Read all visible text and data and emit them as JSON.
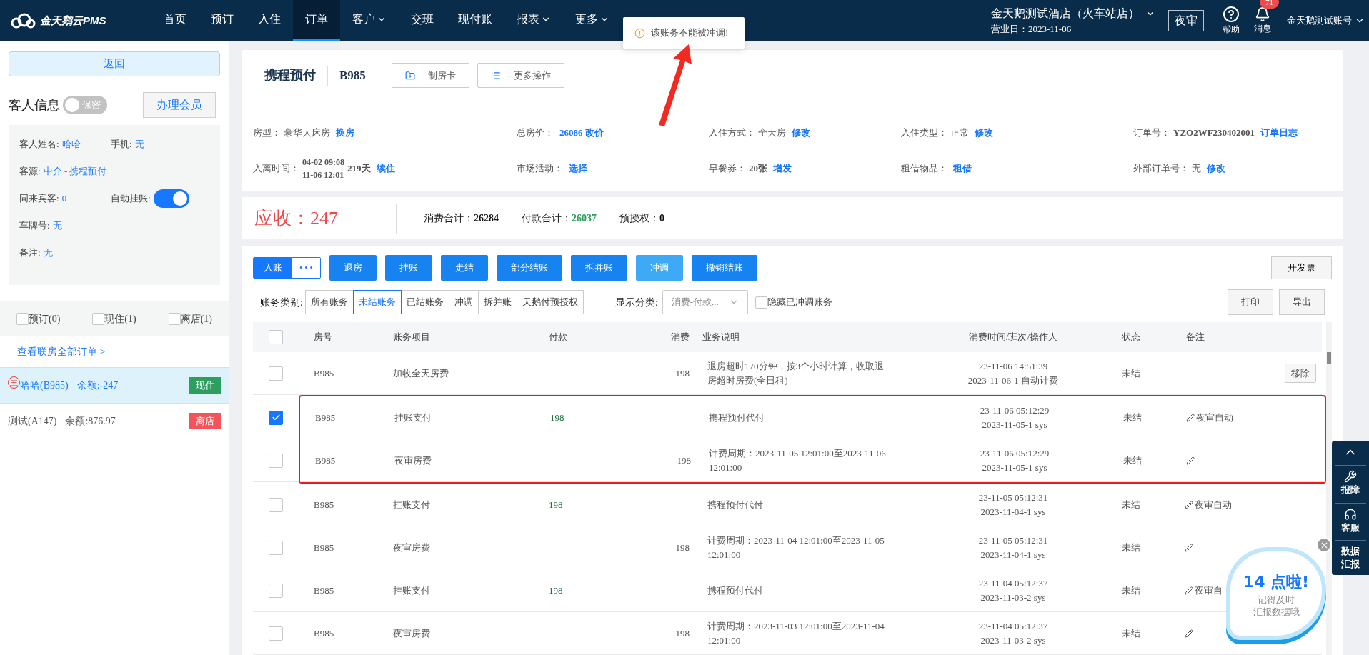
{
  "nav": {
    "logo": "金天鹅云PMS",
    "items": [
      {
        "label": "首页",
        "selected": false,
        "dropdown": false
      },
      {
        "label": "预订",
        "selected": false,
        "dropdown": false
      },
      {
        "label": "入住",
        "selected": false,
        "dropdown": false
      },
      {
        "label": "订单",
        "selected": true,
        "dropdown": false
      },
      {
        "label": "客户",
        "selected": false,
        "dropdown": true
      },
      {
        "label": "交班",
        "selected": false,
        "dropdown": false
      },
      {
        "label": "现付账",
        "selected": false,
        "dropdown": false
      },
      {
        "label": "报表",
        "selected": false,
        "dropdown": true
      },
      {
        "label": "更多",
        "selected": false,
        "dropdown": true
      }
    ],
    "hotel": "金天鹅测试酒店（火车站店）",
    "business_date": "营业日：2023-11-06",
    "night_audit": "夜审",
    "help": "帮助",
    "messages": "消息",
    "message_count": "71",
    "account": "金天鹅测试账号"
  },
  "toast": {
    "text": "该账务不能被冲调!"
  },
  "sidebar": {
    "back": "返回",
    "guest_info_title": "客人信息",
    "privacy": {
      "label": "保密",
      "on": false
    },
    "member_button": "办理会员",
    "field_rows": [
      [
        {
          "kind": "text",
          "label": "客人姓名:",
          "value": "哈哈"
        },
        {
          "kind": "text",
          "label": "手机:",
          "value": "无"
        }
      ],
      [
        {
          "kind": "text",
          "label": "客源:",
          "value": "中介  - 携程预付"
        }
      ],
      [
        {
          "kind": "text",
          "label": "同来宾客:",
          "value": "0"
        },
        {
          "kind": "toggle",
          "label": "自动挂账:",
          "on": true
        }
      ],
      [
        {
          "kind": "text",
          "label": "车牌号:",
          "value": "无"
        }
      ],
      [
        {
          "kind": "text",
          "label": "备注:",
          "value": "无"
        }
      ]
    ],
    "filters": [
      {
        "label": "预订(0)",
        "checked": false
      },
      {
        "label": "现住(1)",
        "checked": false
      },
      {
        "label": "离店(1)",
        "checked": false
      }
    ],
    "all_orders_link": "查看联房全部订单 >",
    "rooms": [
      {
        "main_mark": "主",
        "name": "哈哈(B985)",
        "balance": "余额:-247",
        "status": "现住",
        "color": "#2e9e5e",
        "selected": true
      },
      {
        "name": "测试(A147)",
        "balance": "余额:876.97",
        "status": "离店",
        "color": "#f5535a",
        "selected": false
      }
    ]
  },
  "order": {
    "channel": "携程预付",
    "room": "B985",
    "buttons": [
      {
        "label": "制房卡",
        "kind": "card"
      },
      {
        "label": "更多操作",
        "kind": "list"
      }
    ],
    "info": [
      {
        "label": "房型：",
        "value": "豪华大床房",
        "bold": false,
        "link": "换房"
      },
      {
        "label": "总房价：",
        "link": "26086 改价"
      },
      {
        "label": "入住方式：",
        "value": "全天房",
        "bold": false,
        "link": "修改"
      },
      {
        "label": "入住类型：",
        "value": "正常",
        "bold": false,
        "link": "修改"
      },
      {
        "label": "订单号：",
        "value": "YZO2WF230402001",
        "bold": true,
        "link": "订单日志"
      },
      {
        "label": "入离时间：",
        "dates": [
          "04-02 09:08",
          "11-06 12:01"
        ],
        "value": "219天",
        "bold": true,
        "link": "续住"
      },
      {
        "label": "市场活动：",
        "link": "选择"
      },
      {
        "label": "早餐券：",
        "value": "20张",
        "bold": true,
        "link": "增发"
      },
      {
        "label": "租借物品：",
        "link": "租借"
      },
      {
        "label": "外部订单号：",
        "value": "无",
        "bold": false,
        "link": "修改"
      }
    ]
  },
  "summary": {
    "due": "应收：247",
    "totals": [
      {
        "label": "消费合计：",
        "value": "26284",
        "color": "#111111"
      },
      {
        "label": "付款合计：",
        "value": "26037",
        "color": "#2e9e5e"
      },
      {
        "label": "预授权：",
        "value": "0",
        "color": "#111111"
      }
    ]
  },
  "actions": {
    "post": "入账",
    "post_more": "• • •",
    "buttons": [
      {
        "label": "退房",
        "highlighted": false
      },
      {
        "label": "挂账",
        "highlighted": false
      },
      {
        "label": "走结",
        "highlighted": false
      },
      {
        "label": "部分结账",
        "highlighted": false
      },
      {
        "label": "拆并账",
        "highlighted": false
      },
      {
        "label": "冲调",
        "highlighted": true
      },
      {
        "label": "撤销结账",
        "highlighted": false
      }
    ],
    "invoice": "开发票"
  },
  "filter_bar": {
    "category_label": "账务类别:",
    "categories": [
      {
        "label": "所有账务",
        "selected": false
      },
      {
        "label": "未结账务",
        "selected": true
      },
      {
        "label": "已结账务",
        "selected": false
      },
      {
        "label": "冲调",
        "selected": false
      },
      {
        "label": "拆并账",
        "selected": false
      },
      {
        "label": "天鹅付预授权",
        "selected": false
      }
    ],
    "display_label": "显示分类:",
    "display_value": "消费-付款...",
    "hide_reversed": {
      "label": "隐藏已冲调账务",
      "checked": false
    },
    "print": "打印",
    "export": "导出"
  },
  "table": {
    "all_checked": false,
    "columns": [
      "房号",
      "账务项目",
      "付款",
      "消费",
      "业务说明",
      "消费时间/班次/操作人",
      "状态",
      "备注"
    ],
    "rows": [
      {
        "checked": false,
        "annotated": false,
        "room": "B985",
        "item": "加收全天房费",
        "consumption": "198",
        "description": "退房超时170分钟，按3个小时计算，收取退房超时房费(全日租)",
        "time": [
          "23-11-06 14:51:39",
          "2023-11-06-1 自动计费"
        ],
        "status": "未结",
        "editable": false,
        "action": "移除"
      },
      {
        "checked": true,
        "annotated": true,
        "room": "B985",
        "item": "挂账支付",
        "payment": "198",
        "description": "携程预付代付",
        "time": [
          "23-11-06 05:12:29",
          "2023-11-05-1 sys"
        ],
        "status": "未结",
        "editable": true,
        "note": "夜审自动"
      },
      {
        "checked": false,
        "annotated": true,
        "room": "B985",
        "item": "夜审房费",
        "consumption": "198",
        "description": "计费周期：2023-11-05 12:01:00至2023-11-06 12:01:00",
        "time": [
          "23-11-06 05:12:29",
          "2023-11-05-1 sys"
        ],
        "status": "未结",
        "editable": true
      },
      {
        "checked": false,
        "annotated": false,
        "room": "B985",
        "item": "挂账支付",
        "payment": "198",
        "description": "携程预付代付",
        "time": [
          "23-11-05 05:12:31",
          "2023-11-04-1 sys"
        ],
        "status": "未结",
        "editable": true,
        "note": "夜审自动"
      },
      {
        "checked": false,
        "annotated": false,
        "room": "B985",
        "item": "夜审房费",
        "consumption": "198",
        "description": "计费周期：2023-11-04 12:01:00至2023-11-05 12:01:00",
        "time": [
          "23-11-05 05:12:31",
          "2023-11-04-1 sys"
        ],
        "status": "未结",
        "editable": true
      },
      {
        "checked": false,
        "annotated": false,
        "room": "B985",
        "item": "挂账支付",
        "payment": "198",
        "description": "携程预付代付",
        "time": [
          "23-11-04 05:12:37",
          "2023-11-03-2 sys"
        ],
        "status": "未结",
        "editable": true,
        "note": "夜审自"
      },
      {
        "checked": false,
        "annotated": false,
        "room": "B985",
        "item": "夜审房费",
        "consumption": "198",
        "description": "计费周期：2023-11-03 12:01:00至2023-11-04 12:01:00",
        "time": [
          "23-11-04 05:12:37",
          "2023-11-03-2 sys"
        ],
        "status": "未结",
        "editable": true
      }
    ]
  },
  "float_bar": {
    "items": [
      {
        "kind": "repair",
        "label": "报障"
      },
      {
        "kind": "service",
        "label": "客服"
      },
      {
        "kind": "report",
        "label": "数据汇报"
      }
    ]
  },
  "reminder": {
    "headline": "14 点啦!",
    "lines": [
      "记得及时",
      "汇报数据哦"
    ]
  }
}
